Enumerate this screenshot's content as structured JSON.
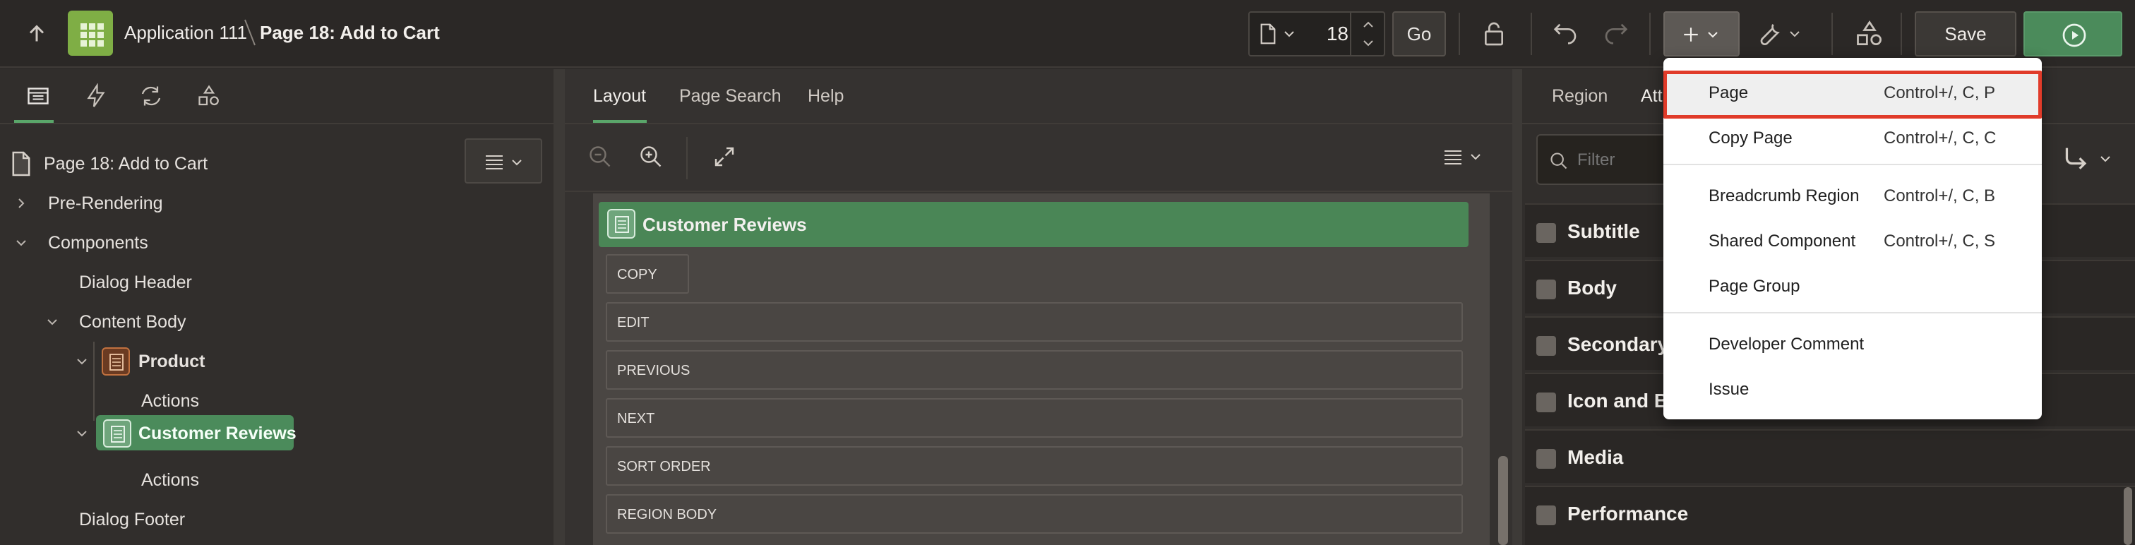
{
  "header": {
    "app_name": "Application 111",
    "page_name": "Page 18: Add to Cart",
    "page_number": "18",
    "go_label": "Go",
    "save_label": "Save"
  },
  "left_panel": {
    "tree_root": "Page 18: Add to Cart",
    "items": [
      {
        "label": "Pre-Rendering"
      },
      {
        "label": "Components"
      },
      {
        "label": "Dialog Header"
      },
      {
        "label": "Content Body"
      },
      {
        "label": "Product"
      },
      {
        "label": "Actions"
      },
      {
        "label": "Customer Reviews"
      },
      {
        "label": "Actions"
      },
      {
        "label": "Dialog Footer"
      }
    ]
  },
  "center": {
    "tabs": [
      "Layout",
      "Page Search",
      "Help"
    ],
    "region_title": "Customer Reviews",
    "slots": [
      "COPY",
      "EDIT",
      "PREVIOUS",
      "NEXT",
      "SORT ORDER",
      "REGION BODY"
    ]
  },
  "right_panel": {
    "tabs": [
      "Region",
      "Att"
    ],
    "filter_placeholder": "Filter",
    "sections": [
      "Subtitle",
      "Body",
      "Secondary",
      "Icon and B",
      "Media",
      "Performance"
    ]
  },
  "create_menu": {
    "items": [
      {
        "label": "Page",
        "shortcut": "Control+/, C, P"
      },
      {
        "label": "Copy Page",
        "shortcut": "Control+/, C, C"
      },
      {
        "label": "Breadcrumb Region",
        "shortcut": "Control+/, C, B"
      },
      {
        "label": "Shared Component",
        "shortcut": "Control+/, C, S"
      },
      {
        "label": "Page Group",
        "shortcut": ""
      },
      {
        "label": "Developer Comment",
        "shortcut": ""
      },
      {
        "label": "Issue",
        "shortcut": ""
      }
    ]
  },
  "colors": {
    "accent_green": "#4b8b5b",
    "app_tile": "#7fae45",
    "highlight_red": "#e03b2a"
  }
}
